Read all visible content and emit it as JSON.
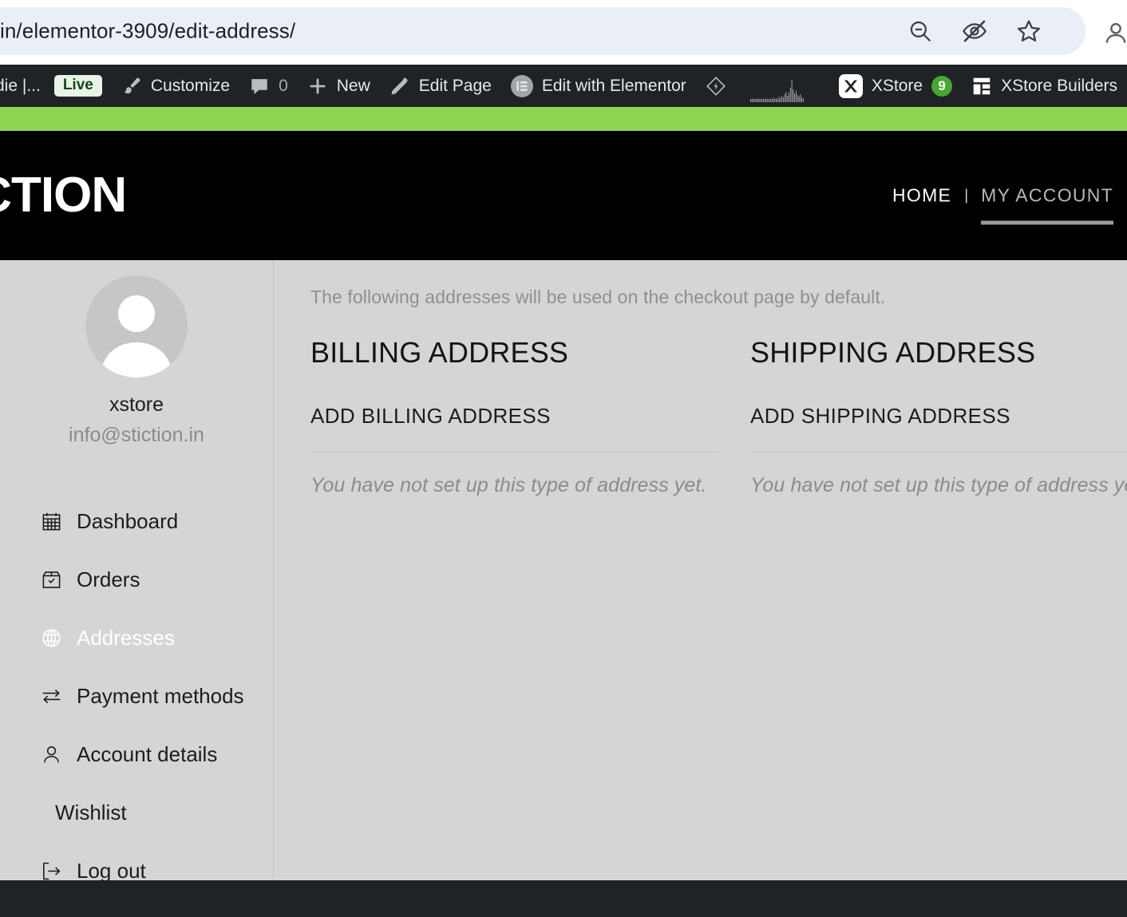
{
  "browser": {
    "url": "in/elementor-3909/edit-address/",
    "actions": [
      {
        "name": "zoom-out-icon",
        "label": "Zoom out"
      },
      {
        "name": "eye-slash-icon",
        "label": "Hidden"
      },
      {
        "name": "bookmark-star-icon",
        "label": "Bookmark"
      }
    ],
    "profile_label": "Profile"
  },
  "adminbar": {
    "site_title": "die |...",
    "live_badge": "Live",
    "customize": "Customize",
    "comments_count": "0",
    "new": "New",
    "edit_page": "Edit Page",
    "edit_with_elementor": "Edit with Elementor",
    "xstore": "XStore",
    "xstore_badge": "9",
    "xstore_builders": "XStore Builders"
  },
  "header": {
    "logo": "ICTION",
    "nav": [
      {
        "label": "HOME",
        "active": false
      },
      {
        "label": "MY ACCOUNT",
        "active": true
      }
    ],
    "separator": "|"
  },
  "sidebar": {
    "user_name": "xstore",
    "user_email": "info@stiction.in",
    "items": [
      {
        "label": "Dashboard",
        "icon": "calendar-icon",
        "active": false
      },
      {
        "label": "Orders",
        "icon": "box-check-icon",
        "active": false
      },
      {
        "label": "Addresses",
        "icon": "globe-icon",
        "active": true
      },
      {
        "label": "Payment methods",
        "icon": "transfer-arrows-icon",
        "active": false
      },
      {
        "label": "Account details",
        "icon": "person-icon",
        "active": false
      },
      {
        "label": "Wishlist",
        "icon": "",
        "active": false
      },
      {
        "label": "Log out",
        "icon": "logout-icon",
        "active": false
      }
    ]
  },
  "content": {
    "intro": "The following addresses will be used on the checkout page by default.",
    "columns": [
      {
        "title": "BILLING ADDRESS",
        "add_link": "ADD BILLING ADDRESS",
        "empty_text": "You have not set up this type of address yet."
      },
      {
        "title": "SHIPPING ADDRESS",
        "add_link": "ADD SHIPPING ADDRESS",
        "empty_text": "You have not set up this type of address yet."
      }
    ]
  },
  "colors": {
    "accent_green": "#8ed44f",
    "admin_bar": "#1f2326",
    "header_black": "#000000",
    "page_bg": "#d5d5d5",
    "badge_green": "#46a832"
  }
}
